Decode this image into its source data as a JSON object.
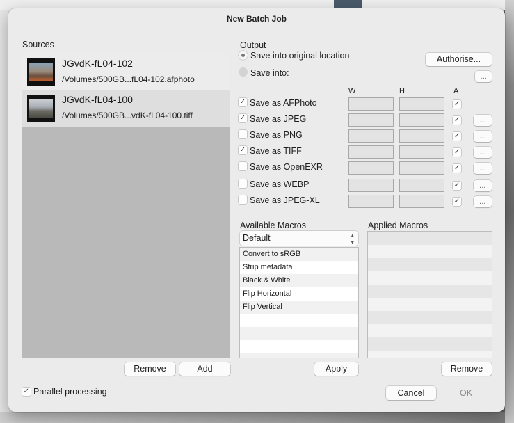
{
  "dialog": {
    "title": "New Batch Job"
  },
  "sources": {
    "heading": "Sources",
    "items": [
      {
        "name": "JGvdK-fL04-102",
        "path": "/Volumes/500GB...fL04-102.afphoto"
      },
      {
        "name": "JGvdK-fL04-100",
        "path": "/Volumes/500GB...vdK-fL04-100.tiff"
      }
    ],
    "remove_label": "Remove",
    "add_label": "Add"
  },
  "output": {
    "heading": "Output",
    "save_original_label": "Save into original location",
    "save_into_label": "Save into:",
    "save_original_selected": true,
    "authorise_label": "Authorise...",
    "ellipsis": "...",
    "col_w": "W",
    "col_h": "H",
    "col_a": "A",
    "formats": [
      {
        "label": "Save as AFPhoto",
        "checked": true,
        "a_checked": true,
        "has_more": false
      },
      {
        "label": "Save as JPEG",
        "checked": true,
        "a_checked": true,
        "has_more": true
      },
      {
        "label": "Save as PNG",
        "checked": false,
        "a_checked": true,
        "has_more": true
      },
      {
        "label": "Save as TIFF",
        "checked": true,
        "a_checked": true,
        "has_more": true
      },
      {
        "label": "Save as OpenEXR",
        "checked": false,
        "a_checked": true,
        "has_more": true
      },
      {
        "label": "Save as WEBP",
        "checked": false,
        "a_checked": true,
        "has_more": true
      },
      {
        "label": "Save as JPEG-XL",
        "checked": false,
        "a_checked": true,
        "has_more": true
      }
    ]
  },
  "macros": {
    "available_heading": "Available Macros",
    "applied_heading": "Applied Macros",
    "category": "Default",
    "available": [
      "Convert to sRGB",
      "Strip metadata",
      "Black & White",
      "Flip Horizontal",
      "Flip Vertical"
    ],
    "applied": [],
    "apply_label": "Apply",
    "remove_label": "Remove"
  },
  "footer": {
    "parallel_label": "Parallel processing",
    "parallel_checked": true,
    "cancel_label": "Cancel",
    "ok_label": "OK"
  },
  "glyphs": {
    "check": "✓",
    "updown": "⌃⌄"
  }
}
